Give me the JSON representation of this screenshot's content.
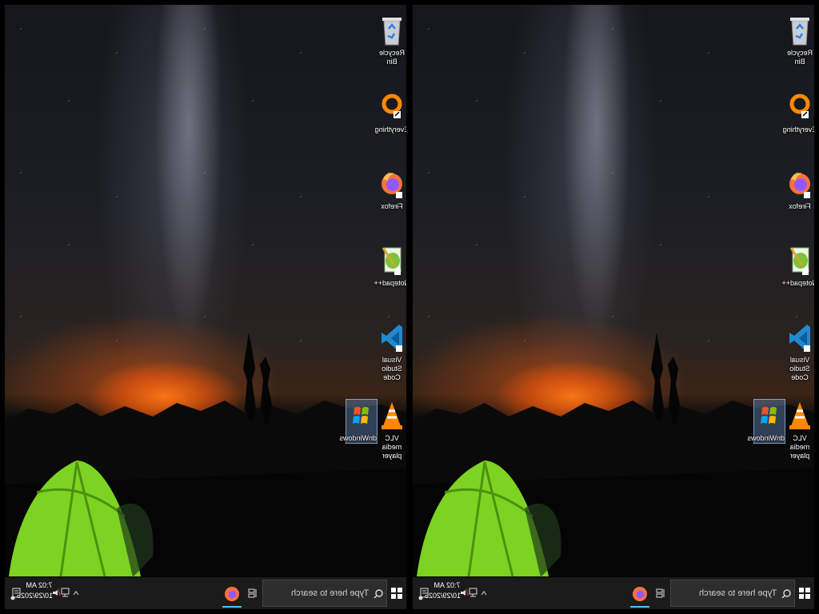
{
  "desktop_icons": [
    {
      "label": "Recycle Bin",
      "icon": "recycle-bin-icon"
    },
    {
      "label": "Everything",
      "icon": "everything-search-icon"
    },
    {
      "label": "Firefox",
      "icon": "firefox-icon"
    },
    {
      "label": "Notepad++",
      "icon": "notepad-plus-plus-icon"
    },
    {
      "label": "Visual Studio Code",
      "icon": "vscode-icon"
    },
    {
      "label": "VLC media player",
      "icon": "vlc-icon"
    },
    {
      "label": "dnWindows",
      "icon": "windows-xp-logo-icon"
    }
  ],
  "taskbar": {
    "search_placeholder": "Type here to search",
    "clock_time": "7:02 AM",
    "clock_date": "10/29/2025"
  },
  "colors": {
    "taskbar_bg": "#1b1b1b",
    "search_bg": "#2d2d2d",
    "accent": "#4cc2ff",
    "tent_green": "#7dd321",
    "horizon_orange": "#ff7a1a"
  }
}
